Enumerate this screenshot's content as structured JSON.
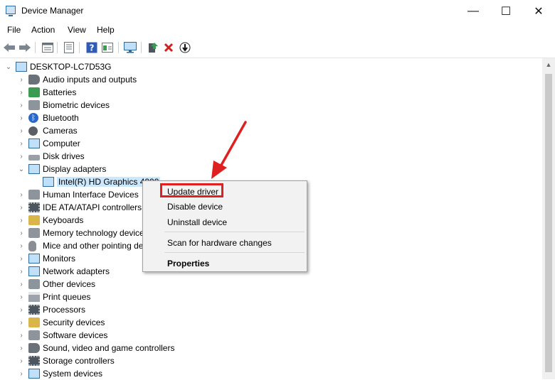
{
  "window": {
    "title": "Device Manager",
    "minimize": "—",
    "maximize": "☐",
    "close": "✕"
  },
  "menu": [
    "File",
    "Action",
    "View",
    "Help"
  ],
  "toolbar": [
    "back-arrow-icon",
    "forward-arrow-icon",
    "properties-icon",
    "refresh-icon",
    "help-icon",
    "view-icon",
    "monitor-icon",
    "update-driver-icon",
    "uninstall-icon",
    "disable-icon"
  ],
  "tree": {
    "root": "DESKTOP-LC7D53G",
    "categories": [
      "Audio inputs and outputs",
      "Batteries",
      "Biometric devices",
      "Bluetooth",
      "Cameras",
      "Computer",
      "Disk drives",
      "Display adapters",
      "Human Interface Devices",
      "IDE ATA/ATAPI controllers",
      "Keyboards",
      "Memory technology devices",
      "Mice and other pointing devices",
      "Monitors",
      "Network adapters",
      "Other devices",
      "Print queues",
      "Processors",
      "Security devices",
      "Software devices",
      "Sound, video and game controllers",
      "Storage controllers",
      "System devices"
    ],
    "selected_child": "Intel(R) HD Graphics 4000"
  },
  "context_menu": {
    "update": "Update driver",
    "disable": "Disable device",
    "uninstall": "Uninstall device",
    "scan": "Scan for hardware changes",
    "properties": "Properties"
  },
  "colors": {
    "highlight": "#e02020",
    "selection": "#cce8ff",
    "arrow": "#e02020"
  }
}
